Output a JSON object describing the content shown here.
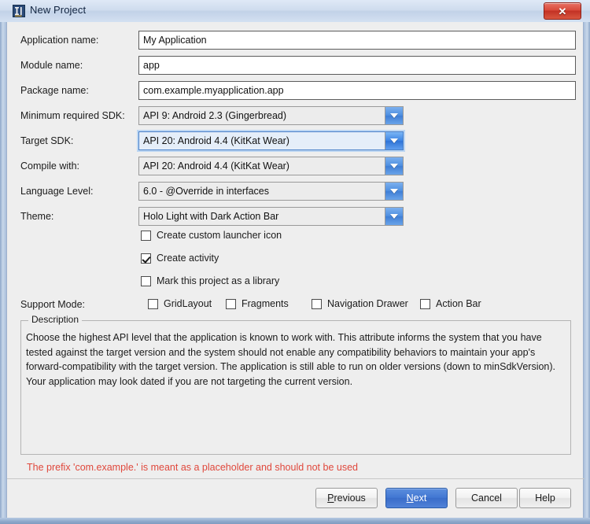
{
  "window": {
    "title": "New Project",
    "icon": "intellij-logo-icon",
    "close_label": "✕",
    "accent_blue": "#4277d2",
    "error_red": "#e0483c"
  },
  "form": {
    "fields": [
      {
        "label": "Application name:",
        "value": "My Application",
        "type": "text"
      },
      {
        "label": "Module name:",
        "value": "app",
        "type": "text"
      },
      {
        "label": "Package name:",
        "value": "com.example.myapplication.app",
        "type": "text"
      },
      {
        "label": "Minimum required SDK:",
        "value": "API 9: Android 2.3 (Gingerbread)",
        "type": "combo"
      },
      {
        "label": "Target SDK:",
        "value": "API 20: Android 4.4 (KitKat Wear)",
        "type": "combo",
        "focused": true
      },
      {
        "label": "Compile with:",
        "value": "API 20: Android 4.4 (KitKat Wear)",
        "type": "combo"
      },
      {
        "label": "Language Level:",
        "value": "6.0 - @Override in interfaces",
        "type": "combo"
      },
      {
        "label": "Theme:",
        "value": "Holo Light with Dark Action Bar",
        "type": "combo"
      }
    ],
    "options": [
      {
        "label": "Create custom launcher icon",
        "checked": false
      },
      {
        "label": "Create activity",
        "checked": true
      },
      {
        "label": "Mark this project as a library",
        "checked": false
      }
    ],
    "support_mode": {
      "label": "Support Mode:",
      "items": [
        {
          "label": "GridLayout",
          "checked": false
        },
        {
          "label": "Fragments",
          "checked": false
        },
        {
          "label": "Navigation Drawer",
          "checked": false
        },
        {
          "label": "Action Bar",
          "checked": false
        }
      ]
    }
  },
  "description": {
    "legend": "Description",
    "text": "Choose the highest API level that the application is known to work with. This attribute informs the system that you have tested against the target version and the system should not enable any compatibility behaviors to maintain your app's forward-compatibility with the target version. The application is still able to run on older versions (down to minSdkVersion). Your application may look dated if you are not targeting the current version."
  },
  "error": "The prefix 'com.example.' is meant as a placeholder and should not be used",
  "buttons": [
    {
      "name": "previous",
      "pre": "",
      "mnemonic": "P",
      "post": "revious",
      "default": false
    },
    {
      "name": "next",
      "pre": "",
      "mnemonic": "N",
      "post": "ext",
      "default": true
    },
    {
      "name": "cancel",
      "pre": "Cancel",
      "mnemonic": "",
      "post": "",
      "default": false
    },
    {
      "name": "help",
      "pre": "Help",
      "mnemonic": "",
      "post": "",
      "default": false
    }
  ]
}
